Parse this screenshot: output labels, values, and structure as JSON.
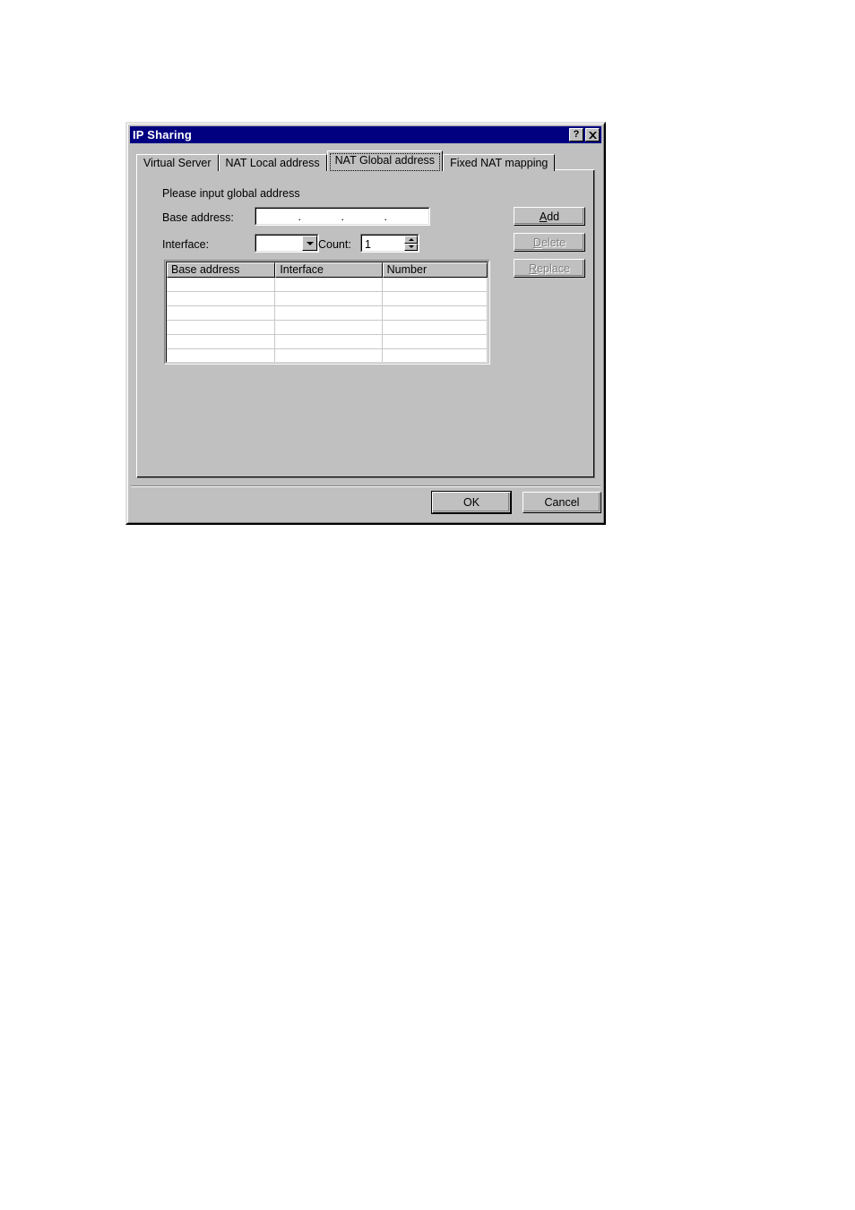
{
  "window": {
    "title": "IP Sharing",
    "help_button": "?",
    "close_button": "✕"
  },
  "tabs": [
    {
      "label": "Virtual Server",
      "selected": false
    },
    {
      "label": "NAT Local address",
      "selected": false
    },
    {
      "label": "NAT Global address",
      "selected": true
    },
    {
      "label": "Fixed NAT mapping",
      "selected": false
    }
  ],
  "form": {
    "hint": "Please input global address",
    "base_address_label": "Base address:",
    "base_address_value": "",
    "base_address_octets": [
      "",
      "",
      "",
      ""
    ],
    "ip_separator": ".",
    "interface_label": "Interface:",
    "interface_value": "",
    "interface_options": [],
    "count_label": "Count:",
    "count_value": "1"
  },
  "buttons": {
    "add": {
      "label": "Add",
      "accel": "A",
      "enabled": true
    },
    "delete": {
      "label": "Delete",
      "accel": "D",
      "enabled": false
    },
    "replace": {
      "label": "Replace",
      "accel": "R",
      "enabled": false
    },
    "ok": {
      "label": "OK",
      "enabled": true,
      "default": true
    },
    "cancel": {
      "label": "Cancel",
      "enabled": true
    }
  },
  "table": {
    "columns": [
      "Base address",
      "Interface",
      "Number"
    ],
    "rows": [
      [
        "",
        "",
        ""
      ],
      [
        "",
        "",
        ""
      ],
      [
        "",
        "",
        ""
      ],
      [
        "",
        "",
        ""
      ],
      [
        "",
        "",
        ""
      ],
      [
        "",
        "",
        ""
      ],
      [
        "",
        "",
        ""
      ],
      [
        "",
        "",
        ""
      ],
      [
        "",
        "",
        ""
      ],
      [
        "",
        "",
        ""
      ],
      [
        "",
        "",
        ""
      ],
      [
        "",
        "",
        ""
      ]
    ],
    "row_count": 12,
    "empty": true
  },
  "colors": {
    "titlebar": "#000080",
    "titlebar_text": "#ffffff",
    "face": "#c0c0c0",
    "field": "#ffffff",
    "disabled_text": "#808080",
    "text": "#000000"
  }
}
